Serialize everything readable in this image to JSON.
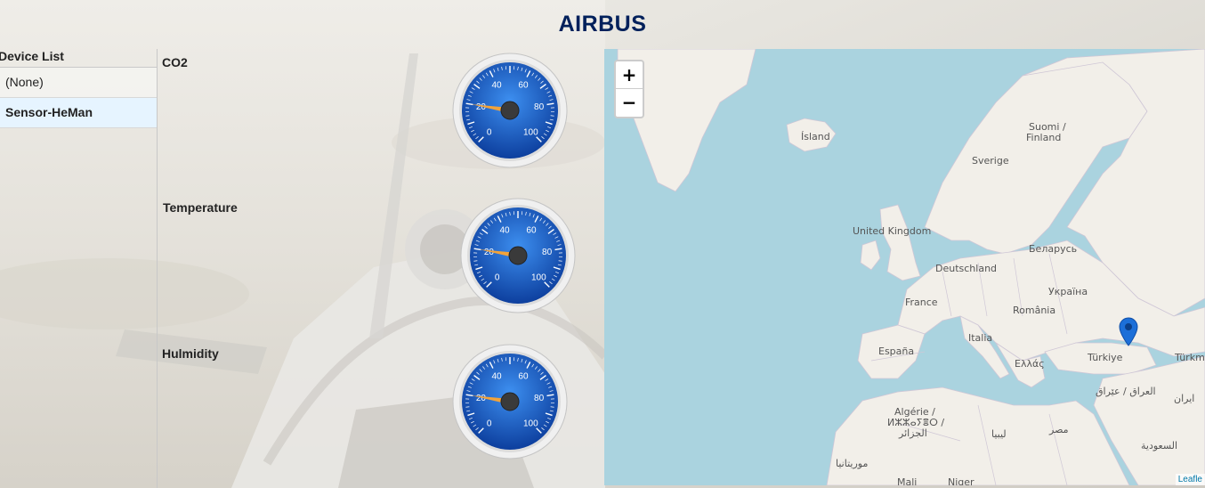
{
  "header": {
    "logo_text": "AIRBUS"
  },
  "sidebar": {
    "title": "Device List",
    "items": [
      {
        "label": "(None)",
        "selected": false
      },
      {
        "label": "Sensor-HeMan",
        "selected": true
      }
    ]
  },
  "gauges": [
    {
      "label": "CO2",
      "value": 20,
      "min": 0,
      "max": 100,
      "ticks": [
        "0",
        "20",
        "40",
        "60",
        "80",
        "100"
      ]
    },
    {
      "label": "Temperature",
      "value": 20,
      "min": 0,
      "max": 100,
      "ticks": [
        "0",
        "20",
        "40",
        "60",
        "80",
        "100"
      ]
    },
    {
      "label": "Hulmidity",
      "value": 20,
      "min": 0,
      "max": 100,
      "ticks": [
        "0",
        "20",
        "40",
        "60",
        "80",
        "100"
      ]
    }
  ],
  "map": {
    "zoom_in": "+",
    "zoom_out": "−",
    "attribution": "Leafle",
    "labels": {
      "island": "Ísland",
      "suomi1": "Suomi /",
      "suomi2": "Finland",
      "sverige": "Sverige",
      "uk": "United Kingdom",
      "belarus": "Беларусь",
      "deutschland": "Deutschland",
      "ukraina": "Україна",
      "france": "France",
      "romania": "România",
      "italia": "Italia",
      "espana": "España",
      "ellas": "Ελλάς",
      "turkiye": "Türkiye",
      "turkmen": "Türkme",
      "iraq": "العراق / عێراق",
      "iran": "ایران",
      "algerie1": "Algérie /",
      "algerie2": "ⵍⵣⵣⴰⵢⴻⵔ /",
      "algerie3": "الجزائر",
      "libya": "ليبيا",
      "misr": "مصر",
      "saudi": "السعودية",
      "mauritania": "موريتانيا",
      "mali": "Mali",
      "niger": "Niger"
    },
    "marker_color": "#1c6fd8"
  },
  "colors": {
    "logo": "#00205b",
    "gauge_blue": "#1a5fc2",
    "needle": "#f2a33a",
    "water": "#aad3df",
    "land": "#f2efe9"
  }
}
